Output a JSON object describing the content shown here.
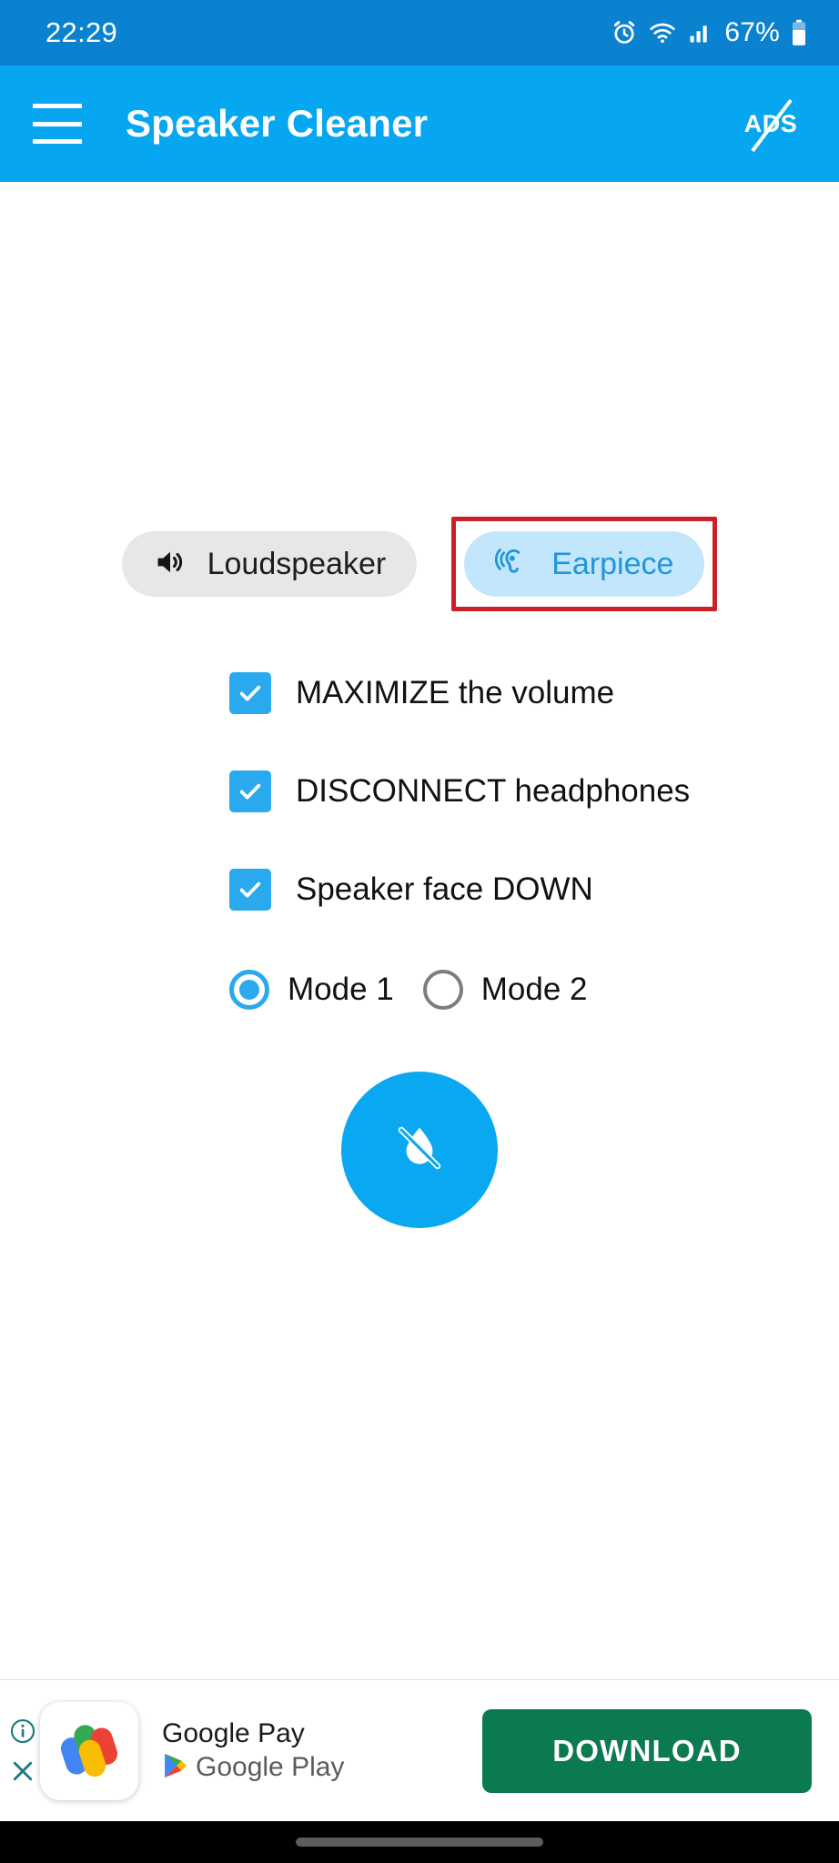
{
  "status_bar": {
    "time": "22:29",
    "battery_percent": "67%",
    "icons": [
      "alarm-icon",
      "wifi-icon",
      "cellular-signal-icon",
      "battery-icon"
    ],
    "background_color": "#0b82cf"
  },
  "app_bar": {
    "title": "Speaker Cleaner",
    "menu_icon": "hamburger-menu-icon",
    "action_label": "ADS",
    "action_icon": "no-ads-icon",
    "background_color": "#06a6f0"
  },
  "main": {
    "output_chips": [
      {
        "label": "Loudspeaker",
        "icon": "volume-up-icon",
        "selected": false,
        "background_color": "#e7e7e8",
        "text_color": "#1d1d1d"
      },
      {
        "label": "Earpiece",
        "icon": "ear-icon",
        "selected": true,
        "background_color": "#c2e6fb",
        "text_color": "#2196d9",
        "highlight_color": "#cc2027"
      }
    ],
    "checkboxes": [
      {
        "label": "MAXIMIZE the volume",
        "checked": true
      },
      {
        "label": "DISCONNECT headphones",
        "checked": true
      },
      {
        "label": "Speaker face DOWN",
        "checked": true
      }
    ],
    "modes": [
      {
        "label": "Mode 1",
        "selected": true
      },
      {
        "label": "Mode 2",
        "selected": false
      }
    ],
    "action_button": {
      "icon": "water-drop-off-icon",
      "color": "#09a8f0"
    },
    "accent_color": "#2aa9ef"
  },
  "ad_banner": {
    "info_icon": "info-circle-icon",
    "close_icon": "close-x-icon",
    "app_icon": "google-pay-logo-icon",
    "title": "Google Pay",
    "store_label": "Google Play",
    "store_icon": "google-play-triangle-icon",
    "cta_label": "DOWNLOAD",
    "cta_color": "#0c7a51"
  },
  "nav_bar": {
    "gesture_pill": "home-gesture-pill"
  }
}
